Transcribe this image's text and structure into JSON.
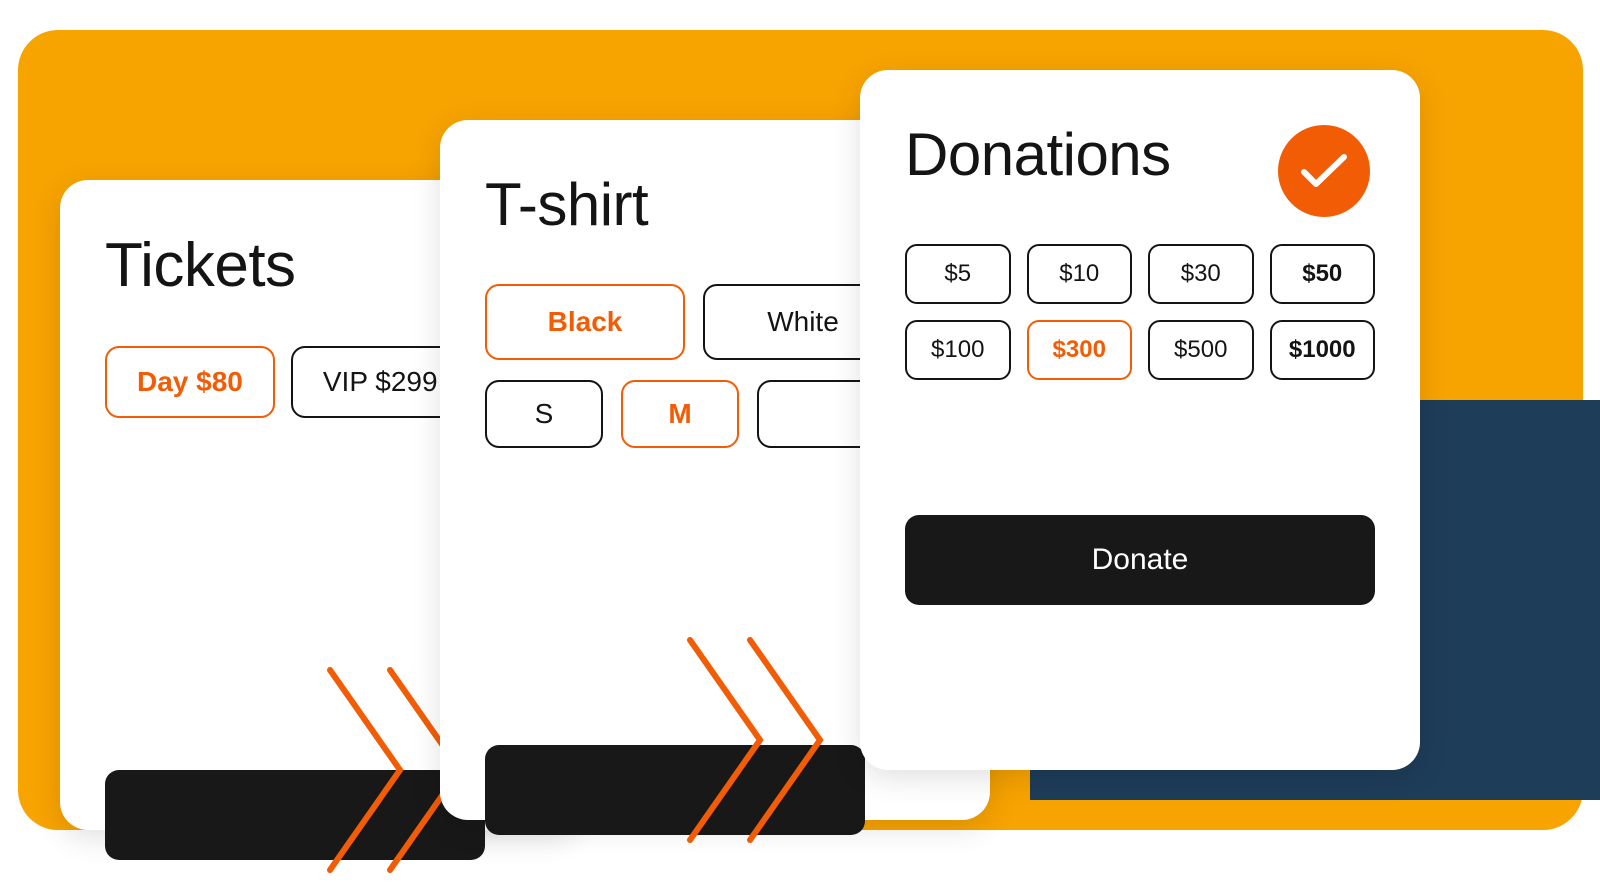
{
  "colors": {
    "accent": "#F25C05",
    "bg_orange": "#F7A300",
    "bg_navy": "#1E3D59",
    "dark": "#181818"
  },
  "tickets": {
    "title": "Tickets",
    "options": [
      {
        "label": "Day $80",
        "selected": true
      },
      {
        "label": "VIP $299",
        "selected": false
      }
    ]
  },
  "tshirt": {
    "title": "T-shirt",
    "colors": [
      {
        "label": "Black",
        "selected": true
      },
      {
        "label": "White",
        "selected": false
      }
    ],
    "sizes": [
      {
        "label": "S",
        "selected": false
      },
      {
        "label": "M",
        "selected": true
      },
      {
        "label": "",
        "selected": false
      }
    ]
  },
  "donations": {
    "title": "Donations",
    "checked": true,
    "amounts": [
      {
        "label": "$5",
        "selected": false,
        "bold": false
      },
      {
        "label": "$10",
        "selected": false,
        "bold": false
      },
      {
        "label": "$30",
        "selected": false,
        "bold": false
      },
      {
        "label": "$50",
        "selected": false,
        "bold": true
      },
      {
        "label": "$100",
        "selected": false,
        "bold": false
      },
      {
        "label": "$300",
        "selected": true,
        "bold": true
      },
      {
        "label": "$500",
        "selected": false,
        "bold": false
      },
      {
        "label": "$1000",
        "selected": false,
        "bold": true
      }
    ],
    "button_label": "Donate"
  }
}
